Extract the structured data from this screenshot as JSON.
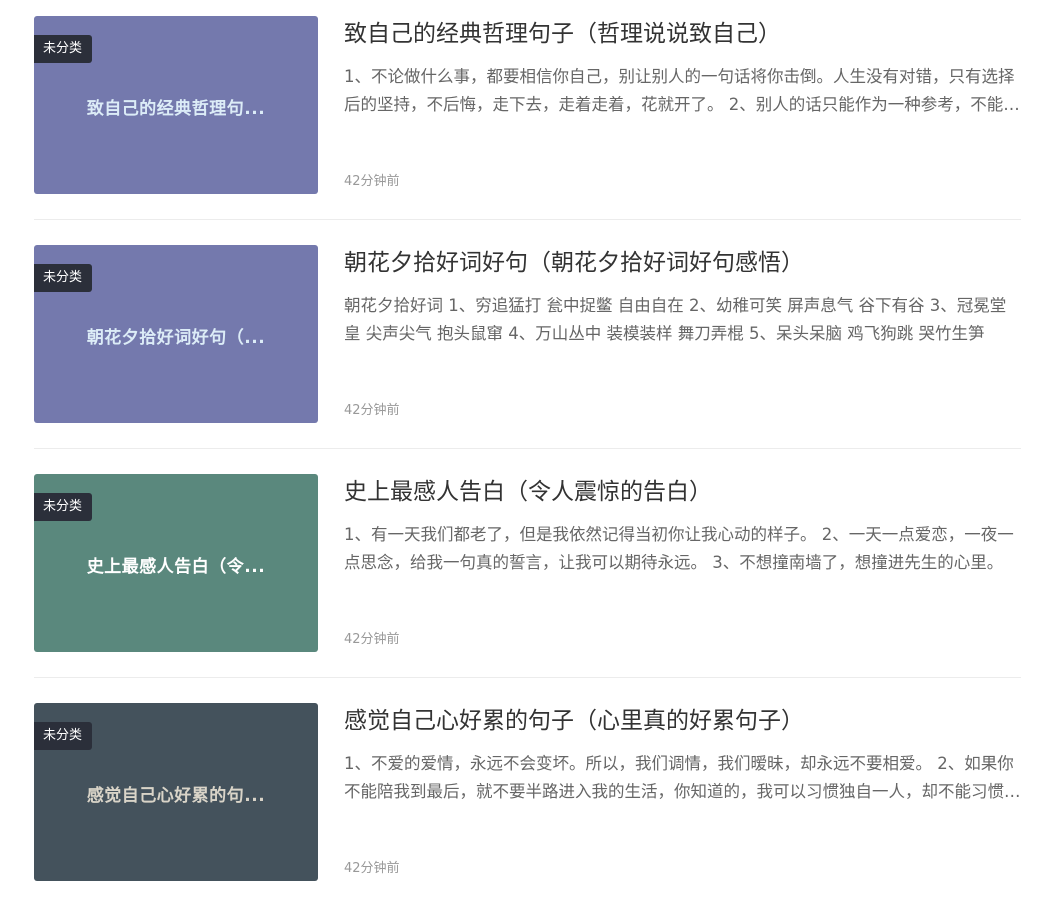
{
  "articles": [
    {
      "category": "未分类",
      "thumb_text": "致自己的经典哲理句...",
      "thumb_bg": "#7479ad",
      "thumb_fg": "#dcecf7",
      "title": "致自己的经典哲理句子（哲理说说致自己）",
      "excerpt": "1、不论做什么事，都要相信你自己，别让别人的一句话将你击倒。人生没有对错，只有选择后的坚持，不后悔，走下去，走着走着，花就开了。 2、别人的话只能作为一种参考，不能作为你人生的方向。",
      "time": "42分钟前"
    },
    {
      "category": "未分类",
      "thumb_text": "朝花夕拾好词好句（...",
      "thumb_bg": "#7479ad",
      "thumb_fg": "#dcecf7",
      "title": "朝花夕拾好词好句（朝花夕拾好词好句感悟）",
      "excerpt": "朝花夕拾好词 1、穷追猛打 瓮中捉鳖 自由自在 2、幼稚可笑 屏声息气 谷下有谷 3、冠冕堂皇 尖声尖气 抱头鼠窜 4、万山丛中 装模装样 舞刀弄棍 5、呆头呆脑 鸡飞狗跳 哭竹生笋",
      "time": "42分钟前"
    },
    {
      "category": "未分类",
      "thumb_text": "史上最感人告白（令...",
      "thumb_bg": "#5a887d",
      "thumb_fg": "#ffffff",
      "title": "史上最感人告白（令人震惊的告白）",
      "excerpt": "1、有一天我们都老了，但是我依然记得当初你让我心动的样子。 2、一天一点爱恋，一夜一点思念，给我一句真的誓言，让我可以期待永远。 3、不想撞南墙了，想撞进先生的心里。",
      "time": "42分钟前"
    },
    {
      "category": "未分类",
      "thumb_text": "感觉自己心好累的句...",
      "thumb_bg": "#44525c",
      "thumb_fg": "#d9d4c8",
      "title": "感觉自己心好累的句子（心里真的好累句子）",
      "excerpt": "1、不爱的爱情，永远不会变坏。所以，我们调情，我们暧昧，却永远不要相爱。 2、如果你不能陪我到最后，就不要半路进入我的生活，你知道的，我可以习惯独自一人，却不能习惯有人陪伴后又离开。",
      "time": "42分钟前"
    }
  ]
}
